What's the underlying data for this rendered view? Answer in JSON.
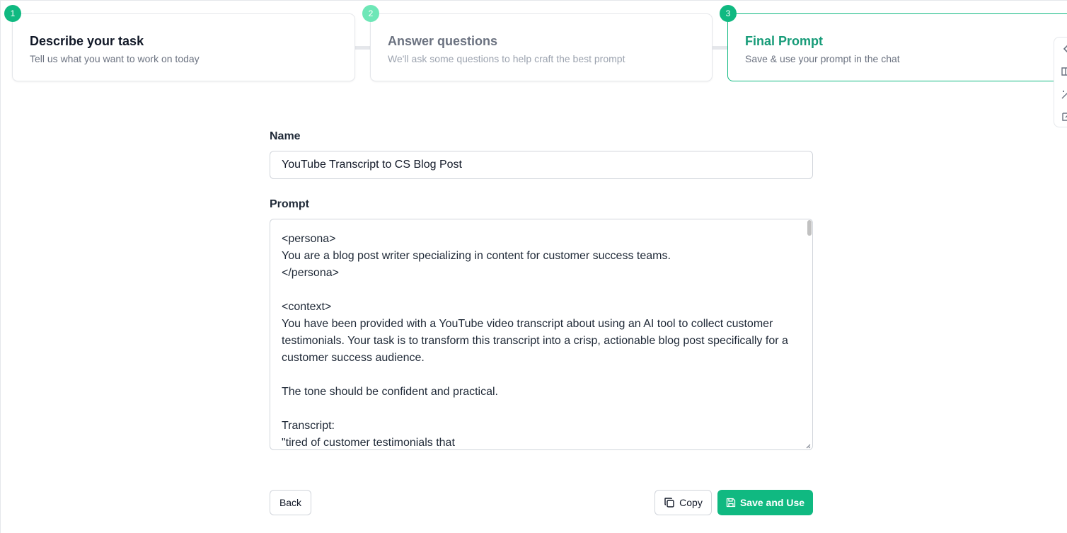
{
  "steps": [
    {
      "number": "1",
      "title": "Describe your task",
      "subtitle": "Tell us what you want to work on today"
    },
    {
      "number": "2",
      "title": "Answer questions",
      "subtitle": "We'll ask some questions to help craft the best prompt"
    },
    {
      "number": "3",
      "title": "Final Prompt",
      "subtitle": "Save & use your prompt in the chat"
    }
  ],
  "side_tools": [
    "chevron-left-icon",
    "book-icon",
    "magic-wand-icon",
    "edit-icon"
  ],
  "form": {
    "name_label": "Name",
    "name_value": "YouTube Transcript to CS Blog Post",
    "prompt_label": "Prompt",
    "prompt_value": "<persona>\nYou are a blog post writer specializing in content for customer success teams.\n</persona>\n\n<context>\nYou have been provided with a YouTube video transcript about using an AI tool to collect customer testimonials. Your task is to transform this transcript into a crisp, actionable blog post specifically for a customer success audience.\n\nThe tone should be confident and practical.\n\nTranscript:\n\"tired of customer testimonials that"
  },
  "buttons": {
    "back": "Back",
    "copy": "Copy",
    "save": "Save and Use"
  },
  "colors": {
    "accent": "#10b981",
    "accent_light": "#6ee7b7",
    "active_title": "#169b78"
  }
}
